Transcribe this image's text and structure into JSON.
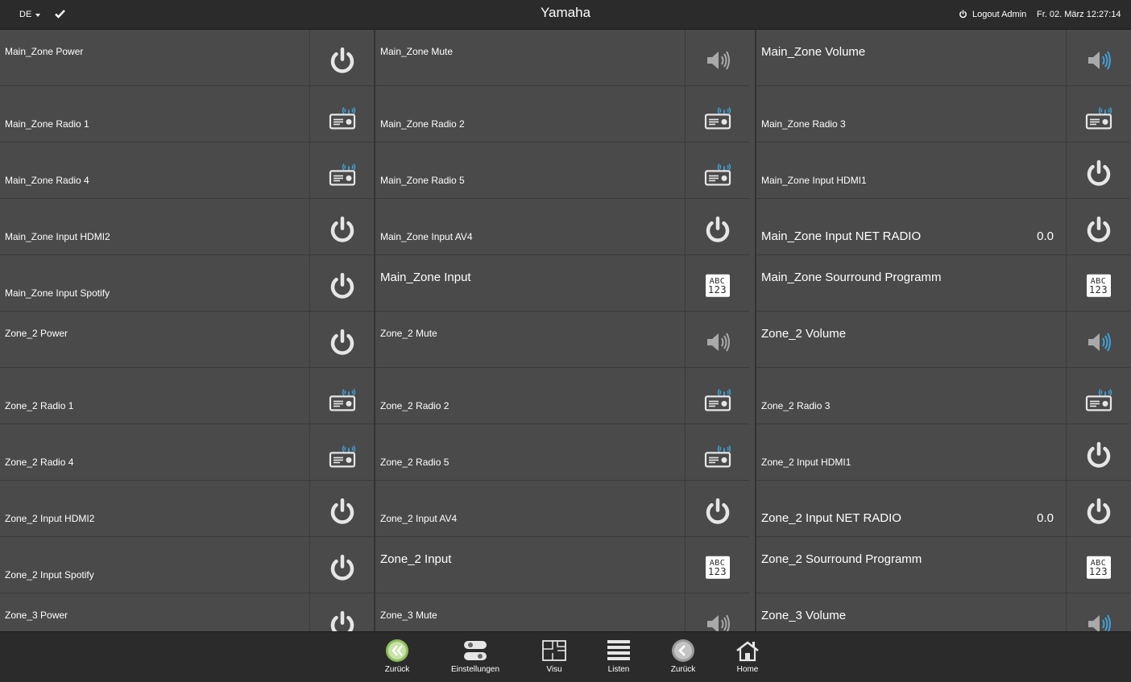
{
  "header": {
    "language": "DE",
    "title": "Yamaha",
    "logout_label": "Logout Admin",
    "datetime": "Fr. 02. März 12:27:14"
  },
  "grid": {
    "columns": [
      [
        {
          "label": "Main_Zone Power",
          "icon": "power-icon"
        },
        {
          "label": "Main_Zone Radio 1",
          "icon": "radio-icon"
        },
        {
          "label": "Main_Zone Radio 4",
          "icon": "radio-icon"
        },
        {
          "label": "Main_Zone Input HDMI2",
          "icon": "power-icon"
        },
        {
          "label": "Main_Zone Input Spotify",
          "icon": "power-icon"
        },
        {
          "label": "Zone_2 Power",
          "icon": "power-icon"
        },
        {
          "label": "Zone_2 Radio 1",
          "icon": "radio-icon"
        },
        {
          "label": "Zone_2 Radio 4",
          "icon": "radio-icon"
        },
        {
          "label": "Zone_2 Input HDMI2",
          "icon": "power-icon"
        },
        {
          "label": "Zone_2 Input Spotify",
          "icon": "power-icon"
        },
        {
          "label": "Zone_3 Power",
          "icon": "power-icon"
        }
      ],
      [
        {
          "label": "Main_Zone Mute",
          "icon": "mute-icon"
        },
        {
          "label": "Main_Zone Radio 2",
          "icon": "radio-icon"
        },
        {
          "label": "Main_Zone Radio 5",
          "icon": "radio-icon"
        },
        {
          "label": "Main_Zone Input AV4",
          "icon": "power-icon"
        },
        {
          "label": "Main_Zone Input",
          "icon": "abc-icon",
          "big": true
        },
        {
          "label": "Zone_2 Mute",
          "icon": "mute-icon"
        },
        {
          "label": "Zone_2 Radio 2",
          "icon": "radio-icon"
        },
        {
          "label": "Zone_2 Radio 5",
          "icon": "radio-icon"
        },
        {
          "label": "Zone_2 Input AV4",
          "icon": "power-icon"
        },
        {
          "label": "Zone_2 Input",
          "icon": "abc-icon",
          "big": true
        },
        {
          "label": "Zone_3 Mute",
          "icon": "mute-icon"
        }
      ],
      [
        {
          "label": "Main_Zone Volume",
          "icon": "volume-icon",
          "big": true
        },
        {
          "label": "Main_Zone Radio 3",
          "icon": "radio-icon"
        },
        {
          "label": "Main_Zone Input HDMI1",
          "icon": "power-icon"
        },
        {
          "label": "Main_Zone Input NET RADIO",
          "icon": "power-icon",
          "big": true,
          "value": "0.0"
        },
        {
          "label": "Main_Zone Sourround Programm",
          "icon": "abc-icon",
          "big": true
        },
        {
          "label": "Zone_2 Volume",
          "icon": "volume-icon",
          "big": true
        },
        {
          "label": "Zone_2 Radio 3",
          "icon": "radio-icon"
        },
        {
          "label": "Zone_2 Input HDMI1",
          "icon": "power-icon"
        },
        {
          "label": "Zone_2 Input NET RADIO",
          "icon": "power-icon",
          "big": true,
          "value": "0.0"
        },
        {
          "label": "Zone_2 Sourround Programm",
          "icon": "abc-icon",
          "big": true
        },
        {
          "label": "Zone_3 Volume",
          "icon": "volume-icon",
          "big": true
        }
      ]
    ],
    "abc_text": {
      "top": "ABC",
      "bottom": "123"
    }
  },
  "footer": {
    "items": [
      {
        "label": "Zurück",
        "icon": "double-chevron-left-icon"
      },
      {
        "label": "Einstellungen",
        "icon": "toggles-icon"
      },
      {
        "label": "Visu",
        "icon": "floorplan-icon"
      },
      {
        "label": "Listen",
        "icon": "list-icon"
      },
      {
        "label": "Zurück",
        "icon": "chevron-left-icon"
      },
      {
        "label": "Home",
        "icon": "home-icon"
      }
    ]
  },
  "colors": {
    "background": "#4a4a4a",
    "bar": "#2b2b2b",
    "icon_light": "#e6e6e6",
    "icon_dim": "#a9a9a9",
    "accent_blue": "#3fa0d8",
    "accent_green": "#8dbf5a"
  }
}
